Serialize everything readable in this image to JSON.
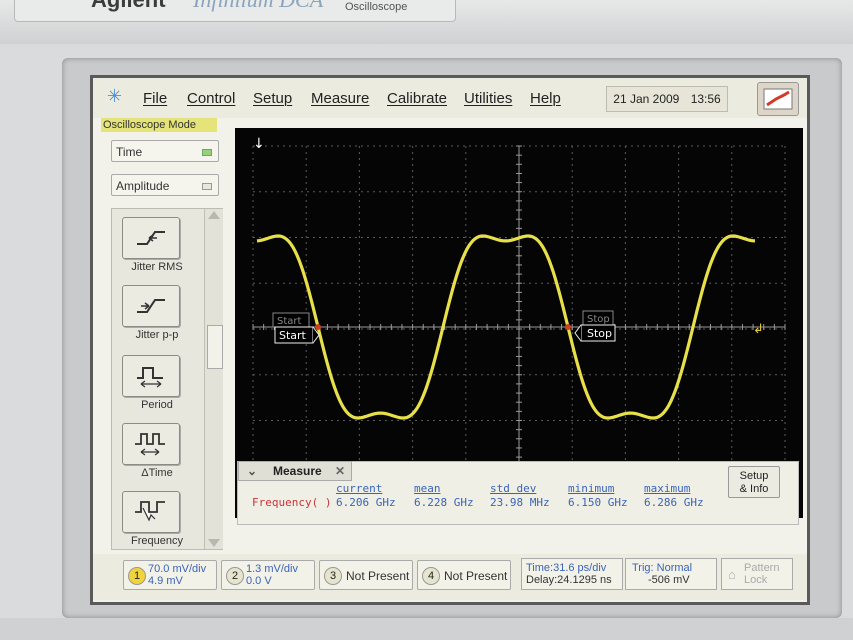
{
  "brand": {
    "company": "Agilent",
    "model": "Infiniium DCA",
    "subtitle": "Oscilloscope"
  },
  "menubar": {
    "icon": "starburst-icon",
    "items": [
      "File",
      "Control",
      "Setup",
      "Measure",
      "Calibrate",
      "Utilities",
      "Help"
    ],
    "date": "21 Jan 2009",
    "time": "13:56"
  },
  "mode_label": "Oscilloscope Mode",
  "sidebar": {
    "dropdown_time": "Time",
    "dropdown_amplitude": "Amplitude",
    "buttons": [
      {
        "label": "Jitter RMS",
        "icon": "jitter-rms-icon"
      },
      {
        "label": "Jitter p-p",
        "icon": "jitter-pp-icon"
      },
      {
        "label": "Period",
        "icon": "period-icon"
      },
      {
        "label": "ΔTime",
        "icon": "delta-time-icon"
      },
      {
        "label": "Frequency",
        "icon": "frequency-icon"
      }
    ]
  },
  "scope": {
    "markers": {
      "start": "Start",
      "stop": "Stop"
    },
    "trace_color": "#e8e04a"
  },
  "measure": {
    "tab_label": "Measure",
    "headers": [
      "current",
      "mean",
      "std dev",
      "minimum",
      "maximum"
    ],
    "row_name": "Frequency( )",
    "values": [
      "6.206 GHz",
      "6.228 GHz",
      "23.98 MHz",
      "6.150 GHz",
      "6.286 GHz"
    ],
    "setup_label_1": "Setup",
    "setup_label_2": "& Info"
  },
  "channels": [
    {
      "num": "1",
      "line1": "70.0 mV/div",
      "line2": "4.9 mV",
      "color": "#e8c82e"
    },
    {
      "num": "2",
      "line1": "1.3 mV/div",
      "line2": "0.0 V",
      "color": "#3a64b8"
    },
    {
      "num": "3",
      "line1": "Not Present",
      "line2": ""
    },
    {
      "num": "4",
      "line1": "Not Present",
      "line2": ""
    }
  ],
  "timebase": {
    "time": "Time:31.6 ps/div",
    "delay": "Delay:24.1295 ns"
  },
  "trigger": {
    "trig": "Trig: Normal",
    "level": "-506 mV"
  },
  "pattern_lock": {
    "line1": "Pattern",
    "line2": "Lock"
  }
}
